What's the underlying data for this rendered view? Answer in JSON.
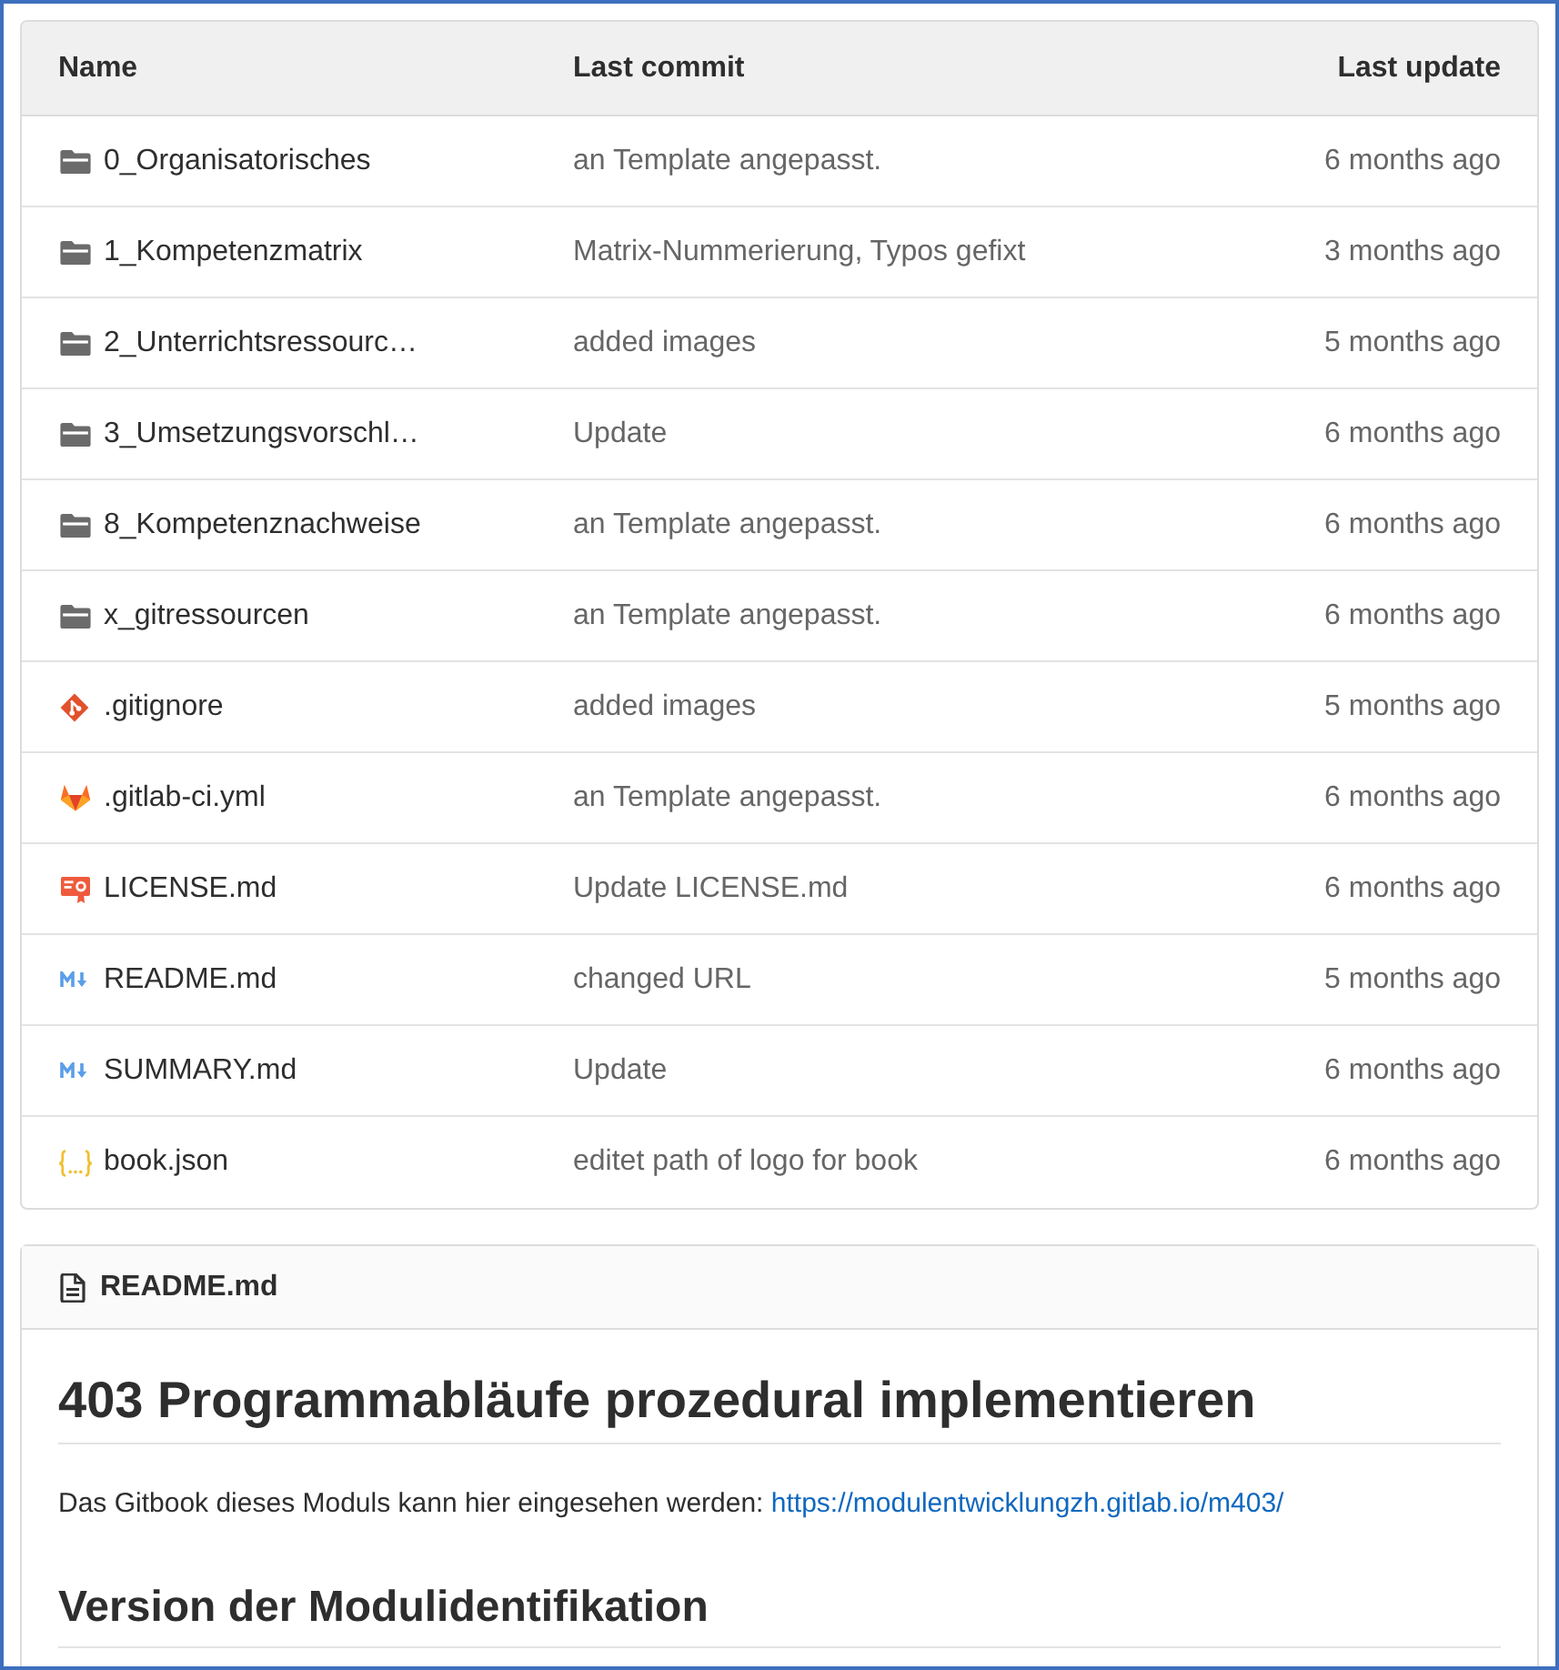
{
  "table": {
    "columns": [
      "Name",
      "Last commit",
      "Last update"
    ],
    "rows": [
      {
        "kind": "folder",
        "name": "0_Organisatorisches",
        "commit": "an Template angepasst.",
        "updated": "6 months ago"
      },
      {
        "kind": "folder",
        "name": "1_Kompetenzmatrix",
        "commit": "Matrix-Nummerierung, Typos gefixt",
        "updated": "3 months ago"
      },
      {
        "kind": "folder",
        "name": "2_Unterrichtsressourc…",
        "commit": "added images",
        "updated": "5 months ago"
      },
      {
        "kind": "folder",
        "name": "3_Umsetzungsvorschl…",
        "commit": "Update",
        "updated": "6 months ago"
      },
      {
        "kind": "folder",
        "name": "8_Kompetenznachweise",
        "commit": "an Template angepasst.",
        "updated": "6 months ago"
      },
      {
        "kind": "folder",
        "name": "x_gitressourcen",
        "commit": "an Template angepasst.",
        "updated": "6 months ago"
      },
      {
        "kind": "git",
        "name": ".gitignore",
        "commit": "added images",
        "updated": "5 months ago"
      },
      {
        "kind": "gitlab",
        "name": ".gitlab-ci.yml",
        "commit": "an Template angepasst.",
        "updated": "6 months ago"
      },
      {
        "kind": "license",
        "name": "LICENSE.md",
        "commit": "Update LICENSE.md",
        "updated": "6 months ago"
      },
      {
        "kind": "markdown",
        "name": "README.md",
        "commit": "changed URL",
        "updated": "5 months ago"
      },
      {
        "kind": "markdown",
        "name": "SUMMARY.md",
        "commit": "Update",
        "updated": "6 months ago"
      },
      {
        "kind": "json",
        "name": "book.json",
        "commit": "editet path of logo for book",
        "updated": "6 months ago"
      }
    ]
  },
  "readme": {
    "filename": "README.md",
    "title": "403 Programmabläufe prozedural implementieren",
    "paragraph": {
      "text": "Das Gitbook dieses Moduls kann hier eingesehen werden:",
      "link": "https://modulentwicklungzh.gitlab.io/m403/"
    },
    "heading": "Version der Modulidentifikation"
  }
}
